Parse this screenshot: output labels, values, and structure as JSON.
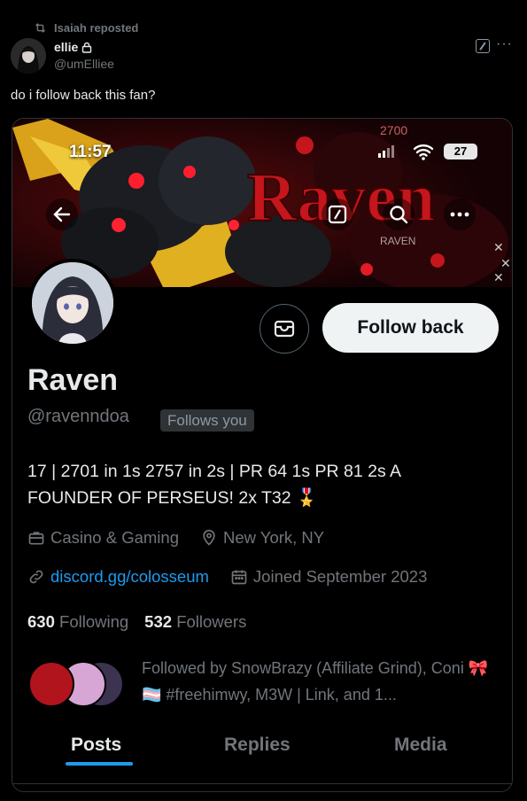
{
  "post": {
    "repost_label": "Isaiah reposted",
    "author_name": "ellie",
    "author_handle": "@umElliee",
    "text": "do i follow back this fan?"
  },
  "screenshot": {
    "status_time": "11:57",
    "battery": "27",
    "profile": {
      "name": "Raven",
      "handle": "@ravenndoa",
      "follows_you": "Follows you",
      "bio": "17 | 2701 in 1s 2757 in 2s | PR 64 1s PR 81 2s A FOUNDER OF PERSEUS! 2x T32 🎖️",
      "category": "Casino & Gaming",
      "location": "New York, NY",
      "link": "discord.gg/colosseum",
      "joined": "Joined September 2023",
      "following_count": "630",
      "following_label": "Following",
      "followers_count": "532",
      "followers_label": "Followers",
      "followed_by": "Followed by SnowBrazy (Affiliate Grind), Coni 🎀🏳️‍⚧️ #freehimwy, M3W | Link, and 1...",
      "follow_back_label": "Follow back"
    },
    "tabs": [
      "Posts",
      "Replies",
      "Media"
    ],
    "active_tab": "Posts"
  },
  "colors": {
    "background": "#000000",
    "text_primary": "#e7e9ea",
    "text_secondary": "#71767b",
    "link": "#1d9bf0",
    "banner_red": "#c4161c"
  }
}
